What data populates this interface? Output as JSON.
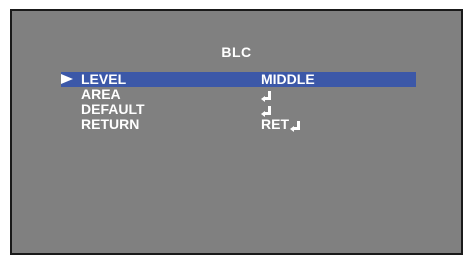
{
  "menu": {
    "title": "BLC",
    "items": [
      {
        "label": "LEVEL",
        "value": "MIDDLE",
        "selected": true
      },
      {
        "label": "AREA",
        "value": "",
        "icon": "enter-icon"
      },
      {
        "label": "DEFAULT",
        "value": "",
        "icon": "enter-icon"
      },
      {
        "label": "RETURN",
        "value": "RET",
        "icon": "enter-icon"
      }
    ]
  },
  "colors": {
    "background": "#808080",
    "highlight": "#3c58a8",
    "text": "#ffffff",
    "border": "#1a1a1a"
  }
}
